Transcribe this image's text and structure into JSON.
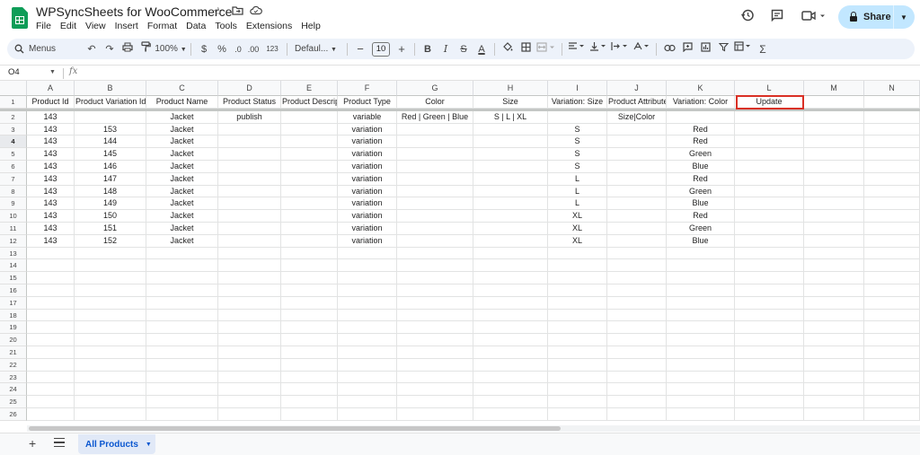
{
  "app": {
    "title": "WPSyncSheets for WooCommerce",
    "menu": [
      "File",
      "Edit",
      "View",
      "Insert",
      "Format",
      "Data",
      "Tools",
      "Extensions",
      "Help"
    ],
    "share_label": "Share"
  },
  "toolbar": {
    "menus_label": "Menus",
    "zoom": "100%",
    "currency": "$",
    "percent": "%",
    "number_format": "123",
    "font": "Defaul...",
    "font_size": "10"
  },
  "formula_bar": {
    "cell_ref": "O4",
    "fx": "fx"
  },
  "grid": {
    "columns": [
      "A",
      "B",
      "C",
      "D",
      "E",
      "F",
      "G",
      "H",
      "I",
      "J",
      "K",
      "L",
      "M",
      "N"
    ],
    "row_numbers": [
      "1",
      "2",
      "3",
      "4",
      "5",
      "6",
      "7",
      "8",
      "9",
      "10",
      "11",
      "12",
      "13",
      "14",
      "15",
      "16",
      "17",
      "18",
      "19",
      "20",
      "21",
      "22",
      "23",
      "24",
      "25",
      "26"
    ],
    "active_row": "4",
    "rows": [
      [
        "Product Id",
        "Product Variation Id",
        "Product Name",
        "Product Status",
        "Product Description",
        "Product Type",
        "Color",
        "Size",
        "Variation: Size",
        "Product Attributes",
        "Variation: Color",
        "Update",
        "",
        ""
      ],
      [
        "143",
        "",
        "Jacket",
        "publish",
        "",
        "variable",
        "Red | Green | Blue",
        "S | L | XL",
        "",
        "Size|Color",
        "",
        "",
        "",
        ""
      ],
      [
        "143",
        "153",
        "Jacket",
        "",
        "",
        "variation",
        "",
        "",
        "S",
        "",
        "Red",
        "",
        "",
        ""
      ],
      [
        "143",
        "144",
        "Jacket",
        "",
        "",
        "variation",
        "",
        "",
        "S",
        "",
        "Red",
        "",
        "",
        ""
      ],
      [
        "143",
        "145",
        "Jacket",
        "",
        "",
        "variation",
        "",
        "",
        "S",
        "",
        "Green",
        "",
        "",
        ""
      ],
      [
        "143",
        "146",
        "Jacket",
        "",
        "",
        "variation",
        "",
        "",
        "S",
        "",
        "Blue",
        "",
        "",
        ""
      ],
      [
        "143",
        "147",
        "Jacket",
        "",
        "",
        "variation",
        "",
        "",
        "L",
        "",
        "Red",
        "",
        "",
        ""
      ],
      [
        "143",
        "148",
        "Jacket",
        "",
        "",
        "variation",
        "",
        "",
        "L",
        "",
        "Green",
        "",
        "",
        ""
      ],
      [
        "143",
        "149",
        "Jacket",
        "",
        "",
        "variation",
        "",
        "",
        "L",
        "",
        "Blue",
        "",
        "",
        ""
      ],
      [
        "143",
        "150",
        "Jacket",
        "",
        "",
        "variation",
        "",
        "",
        "XL",
        "",
        "Red",
        "",
        "",
        ""
      ],
      [
        "143",
        "151",
        "Jacket",
        "",
        "",
        "variation",
        "",
        "",
        "XL",
        "",
        "Green",
        "",
        "",
        ""
      ],
      [
        "143",
        "152",
        "Jacket",
        "",
        "",
        "variation",
        "",
        "",
        "XL",
        "",
        "Blue",
        "",
        "",
        ""
      ]
    ]
  },
  "sheets": {
    "active_tab": "All Products"
  },
  "colors": {
    "accent": "#0b57d0",
    "share_bg": "#c2e7ff",
    "highlight_border": "#d93025",
    "logo": "#0f9d58"
  },
  "icons": [
    "star-icon",
    "move-folder-icon",
    "cloud-status-icon",
    "history-icon",
    "comment-icon",
    "video-call-icon",
    "lock-icon",
    "search-icon",
    "undo-icon",
    "redo-icon",
    "print-icon",
    "paint-format-icon",
    "bold-icon",
    "italic-icon",
    "strikethrough-icon",
    "text-color-icon",
    "fill-color-icon",
    "borders-icon",
    "merge-icon",
    "align-icon",
    "valign-icon",
    "wrap-icon",
    "rotate-icon",
    "link-icon",
    "comment-add-icon",
    "chart-icon",
    "filter-icon",
    "filter-views-icon",
    "functions-icon",
    "add-sheet-icon",
    "all-sheets-icon"
  ]
}
